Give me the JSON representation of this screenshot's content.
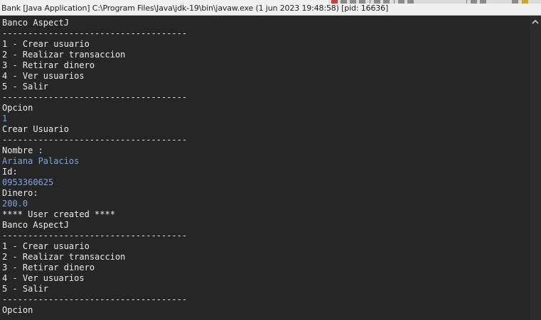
{
  "window": {
    "title": "Bank [Java Application] C:\\Program Files\\Java\\jdk-19\\bin\\javaw.exe  (1 jun 2023 19:48:58) [pid: 16636]"
  },
  "console": {
    "lines": [
      {
        "text": "Banco AspectJ",
        "kind": "output"
      },
      {
        "text": "------------------------------------",
        "kind": "output"
      },
      {
        "text": "1 - Crear usuario",
        "kind": "output"
      },
      {
        "text": "2 - Realizar transaccion",
        "kind": "output"
      },
      {
        "text": "3 - Retirar dinero",
        "kind": "output"
      },
      {
        "text": "4 - Ver usuarios",
        "kind": "output"
      },
      {
        "text": "5 - Salir",
        "kind": "output"
      },
      {
        "text": "------------------------------------",
        "kind": "output"
      },
      {
        "text": "Opcion",
        "kind": "output"
      },
      {
        "text": "1",
        "kind": "input"
      },
      {
        "text": "Crear Usuario",
        "kind": "output"
      },
      {
        "text": "------------------------------------",
        "kind": "output"
      },
      {
        "text": "Nombre :",
        "kind": "output"
      },
      {
        "text": "Ariana Palacios",
        "kind": "input"
      },
      {
        "text": "Id:",
        "kind": "output"
      },
      {
        "text": "0953360625",
        "kind": "input"
      },
      {
        "text": "Dinero:",
        "kind": "output"
      },
      {
        "text": "200.0",
        "kind": "input"
      },
      {
        "text": "**** User created ****",
        "kind": "output"
      },
      {
        "text": "Banco AspectJ",
        "kind": "output"
      },
      {
        "text": "------------------------------------",
        "kind": "output"
      },
      {
        "text": "1 - Crear usuario",
        "kind": "output"
      },
      {
        "text": "2 - Realizar transaccion",
        "kind": "output"
      },
      {
        "text": "3 - Retirar dinero",
        "kind": "output"
      },
      {
        "text": "4 - Ver usuarios",
        "kind": "output"
      },
      {
        "text": "5 - Salir",
        "kind": "output"
      },
      {
        "text": "------------------------------------",
        "kind": "output"
      },
      {
        "text": "Opcion",
        "kind": "output"
      }
    ]
  },
  "scrollbar": {
    "up_icon": "chevron-up-icon"
  }
}
